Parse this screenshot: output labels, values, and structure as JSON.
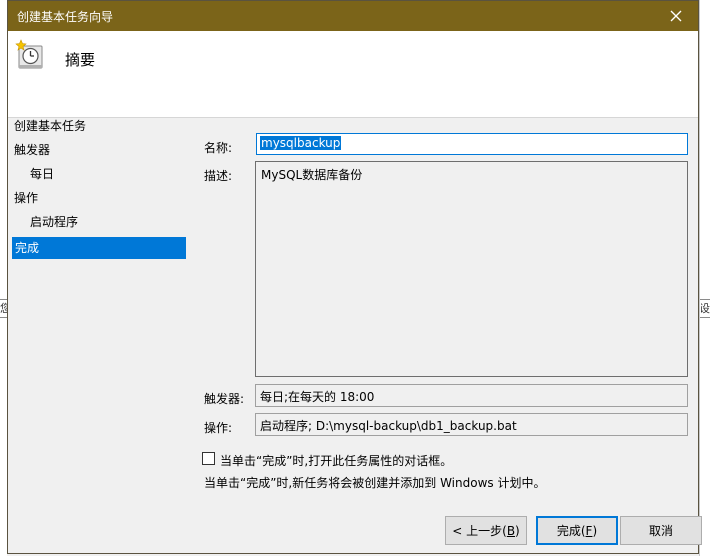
{
  "window": {
    "title": "创建基本任务向导"
  },
  "header": {
    "title": "摘要"
  },
  "nav": {
    "items": [
      "创建基本任务",
      "触发器",
      "每日",
      "操作",
      "启动程序",
      "完成"
    ]
  },
  "form": {
    "name_label": "名称:",
    "name_value": "mysqlbackup",
    "description_label": "描述:",
    "description_value": "MySQL数据库备份",
    "trigger_label": "触发器:",
    "trigger_value": "每日;在每天的 18:00",
    "action_label": "操作:",
    "action_value": "启动程序; D:\\mysql-backup\\db1_backup.bat"
  },
  "checkbox": {
    "label": "当单击“完成”时,打开此任务属性的对话框。"
  },
  "info": {
    "text": "当单击“完成”时,新任务将会被创建并添加到 Windows 计划中。"
  },
  "buttons": {
    "back": {
      "label": "< 上一步(",
      "accel": "B",
      "end": ")"
    },
    "finish": {
      "label": "完成(",
      "accel": "F",
      "end": ")"
    },
    "cancel": {
      "label": "取消"
    }
  },
  "background": {
    "left_glyph": "您",
    "right_glyph": "设"
  },
  "colors": {
    "titlebar": "#7b6419",
    "selection": "#0078d7"
  }
}
